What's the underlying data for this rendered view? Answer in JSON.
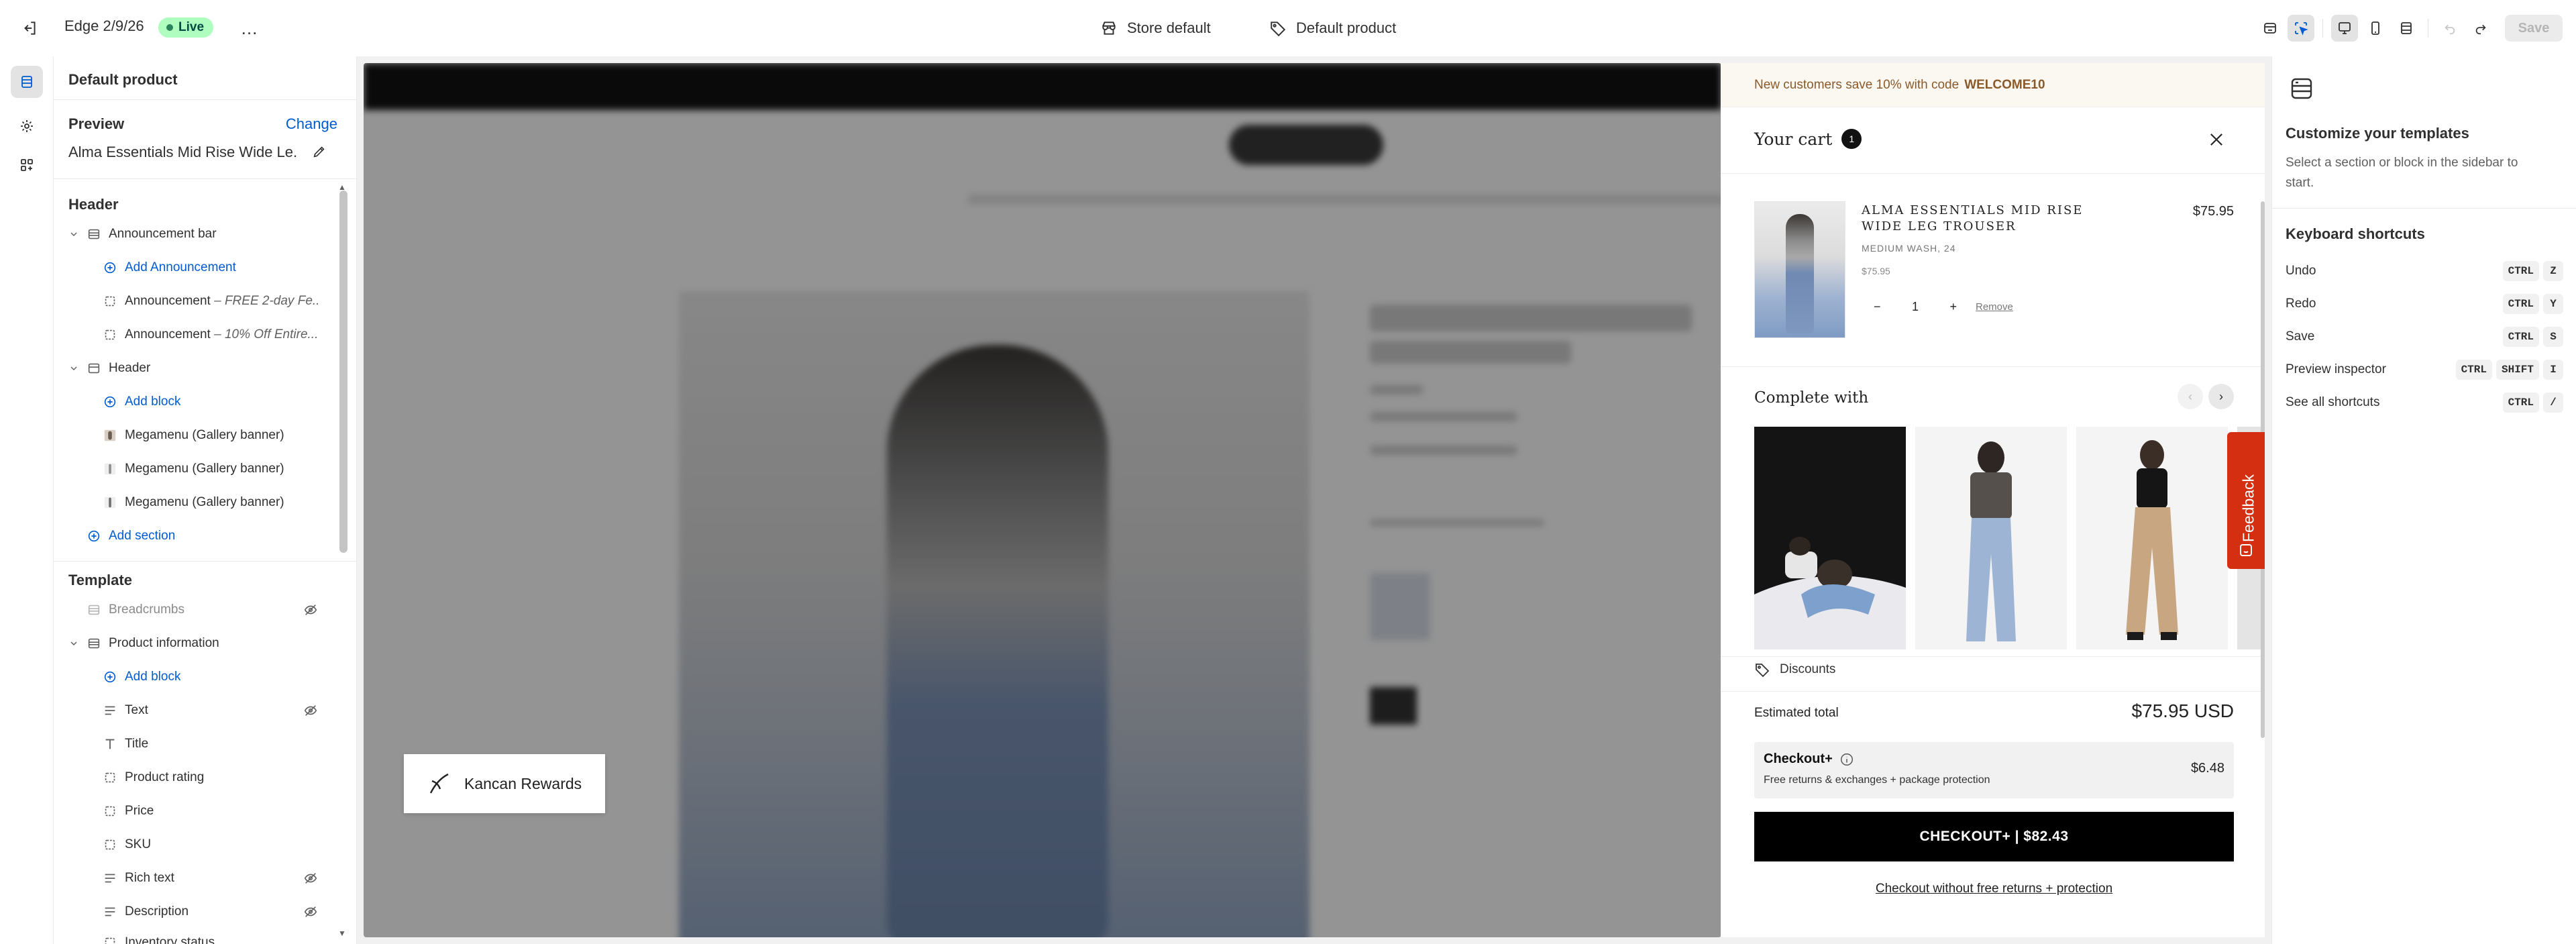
{
  "topbar": {
    "theme_name": "Edge 2/9/26",
    "live_badge": "Live",
    "more_label": "…",
    "store_label": "Store default",
    "template_label": "Default product",
    "save_label": "Save"
  },
  "rail": {
    "items": [
      "sections-icon",
      "theme-settings-icon",
      "app-embeds-icon"
    ]
  },
  "sidebar": {
    "title": "Default product",
    "preview_label": "Preview",
    "change_label": "Change",
    "preview_product": "Alma Essentials Mid Rise Wide Le...",
    "header_group": "Header",
    "template_group": "Template",
    "rows": [
      {
        "label": "Announcement bar"
      },
      {
        "label": "Add Announcement"
      },
      {
        "label": "Announcement",
        "suffix": " – FREE 2-day Fe..."
      },
      {
        "label": "Announcement",
        "suffix": " – 10% Off Entire..."
      },
      {
        "label": "Header"
      },
      {
        "label": "Add block"
      },
      {
        "label": "Megamenu (Gallery banner)"
      },
      {
        "label": "Megamenu (Gallery banner)"
      },
      {
        "label": "Megamenu (Gallery banner)"
      },
      {
        "label": "Add section"
      },
      {
        "label": "Breadcrumbs"
      },
      {
        "label": "Product information"
      },
      {
        "label": "Add block"
      },
      {
        "label": "Text"
      },
      {
        "label": "Title"
      },
      {
        "label": "Product rating"
      },
      {
        "label": "Price"
      },
      {
        "label": "SKU"
      },
      {
        "label": "Rich text"
      },
      {
        "label": "Description"
      },
      {
        "label": "Inventory status"
      }
    ]
  },
  "preview": {
    "rewards_label": "Kancan Rewards"
  },
  "cart": {
    "promo_text": "New customers save 10% with code",
    "promo_code": "WELCOME10",
    "title": "Your cart",
    "count": "1",
    "item": {
      "name": "ALMA ESSENTIALS MID RISE WIDE LEG TROUSER",
      "variant": "MEDIUM WASH, 24",
      "unit_price": "$75.95",
      "price": "$75.95",
      "quantity": "1",
      "remove_label": "Remove"
    },
    "complete_with_title": "Complete with",
    "discounts_label": "Discounts",
    "estimated_label": "Estimated total",
    "estimated_value": "$75.95 USD",
    "checkout_plus": {
      "title": "Checkout+",
      "subtitle": "Free returns & exchanges + package protection",
      "price": "$6.48"
    },
    "checkout_button": "CHECKOUT+ | $82.43",
    "checkout_without": "Checkout without free returns + protection"
  },
  "feedback_label": "Feedback",
  "inspector": {
    "title": "Customize your templates",
    "description": "Select a section or block in the sidebar to start.",
    "shortcuts_title": "Keyboard shortcuts",
    "shortcuts": [
      {
        "label": "Undo",
        "keys": [
          "CTRL",
          "Z"
        ]
      },
      {
        "label": "Redo",
        "keys": [
          "CTRL",
          "Y"
        ]
      },
      {
        "label": "Save",
        "keys": [
          "CTRL",
          "S"
        ]
      },
      {
        "label": "Preview inspector",
        "keys": [
          "CTRL",
          "SHIFT",
          "I"
        ]
      },
      {
        "label": "See all shortcuts",
        "keys": [
          "CTRL",
          "/"
        ]
      }
    ]
  },
  "colors": {
    "accent_link": "#005bd3",
    "live_green": "#affebf",
    "feedback_red": "#d42f10",
    "checkout_black": "#000000"
  }
}
